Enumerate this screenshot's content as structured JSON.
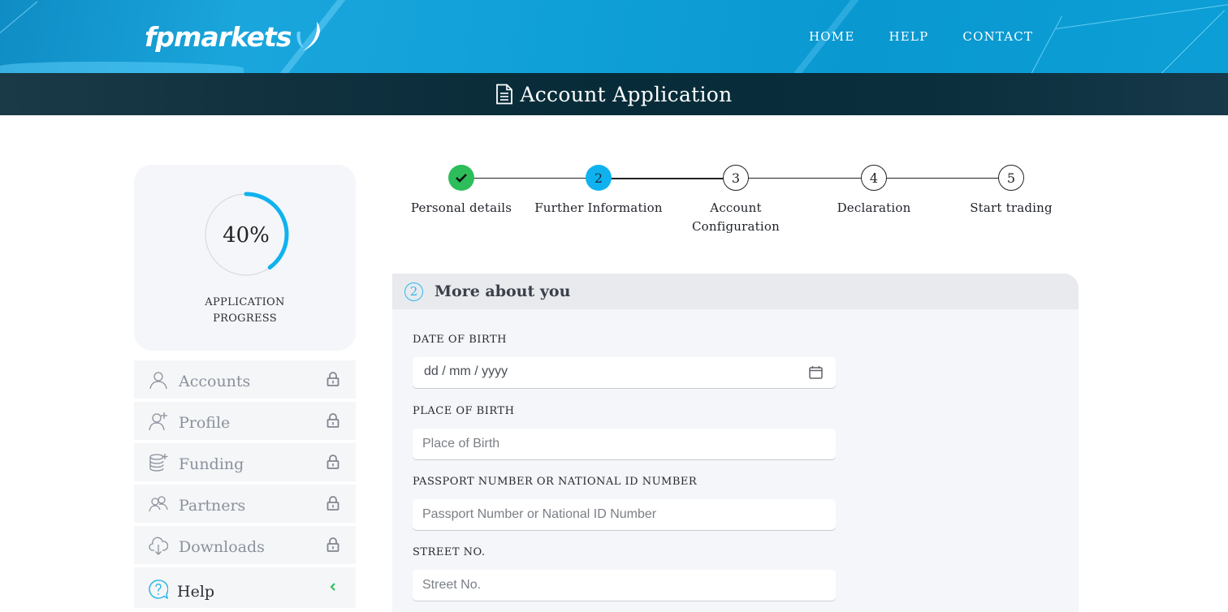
{
  "brand": {
    "name": "fpmarkets",
    "logo_icon": "swoosh-check-icon"
  },
  "nav": {
    "items": [
      {
        "label": "HOME"
      },
      {
        "label": "HELP"
      },
      {
        "label": "CONTACT"
      }
    ]
  },
  "page": {
    "title": "Account Application",
    "title_icon": "document-icon"
  },
  "progress": {
    "value_text": "40%",
    "percent": 40,
    "label_line1": "APPLICATION",
    "label_line2": "PROGRESS",
    "accent_color": "#0fb2ee"
  },
  "sidebar": {
    "items": [
      {
        "label": "Accounts",
        "icon": "user-icon",
        "locked": true
      },
      {
        "label": "Profile",
        "icon": "add-user-icon",
        "locked": true
      },
      {
        "label": "Funding",
        "icon": "coins-stack-icon",
        "locked": true
      },
      {
        "label": "Partners",
        "icon": "users-icon",
        "locked": true
      },
      {
        "label": "Downloads",
        "icon": "cloud-download-icon",
        "locked": true
      },
      {
        "label": "Help",
        "icon": "help-bubble-icon",
        "locked": false
      }
    ]
  },
  "stepper": {
    "steps": [
      {
        "number": "",
        "label_line1": "Personal details",
        "label_line2": "",
        "state": "done"
      },
      {
        "number": "2",
        "label_line1": "Further Information",
        "label_line2": "",
        "state": "active"
      },
      {
        "number": "3",
        "label_line1": "Account",
        "label_line2": "Configuration",
        "state": "pending"
      },
      {
        "number": "4",
        "label_line1": "Declaration",
        "label_line2": "",
        "state": "pending"
      },
      {
        "number": "5",
        "label_line1": "Start trading",
        "label_line2": "",
        "state": "pending"
      }
    ],
    "colors": {
      "done": "#2dbd5a",
      "active": "#0fb2ee"
    }
  },
  "form": {
    "section_number": "2",
    "section_title": "More about you",
    "fields": {
      "dob": {
        "label": "DATE OF BIRTH",
        "value": "dd / mm / yyyy"
      },
      "pob": {
        "label": "PLACE OF BIRTH",
        "placeholder": "Place of Birth",
        "value": ""
      },
      "passport": {
        "label": "PASSPORT NUMBER OR NATIONAL ID NUMBER",
        "placeholder": "Passport Number or National ID Number",
        "value": ""
      },
      "street": {
        "label": "STREET NO.",
        "placeholder": "Street No.",
        "value": ""
      }
    }
  }
}
